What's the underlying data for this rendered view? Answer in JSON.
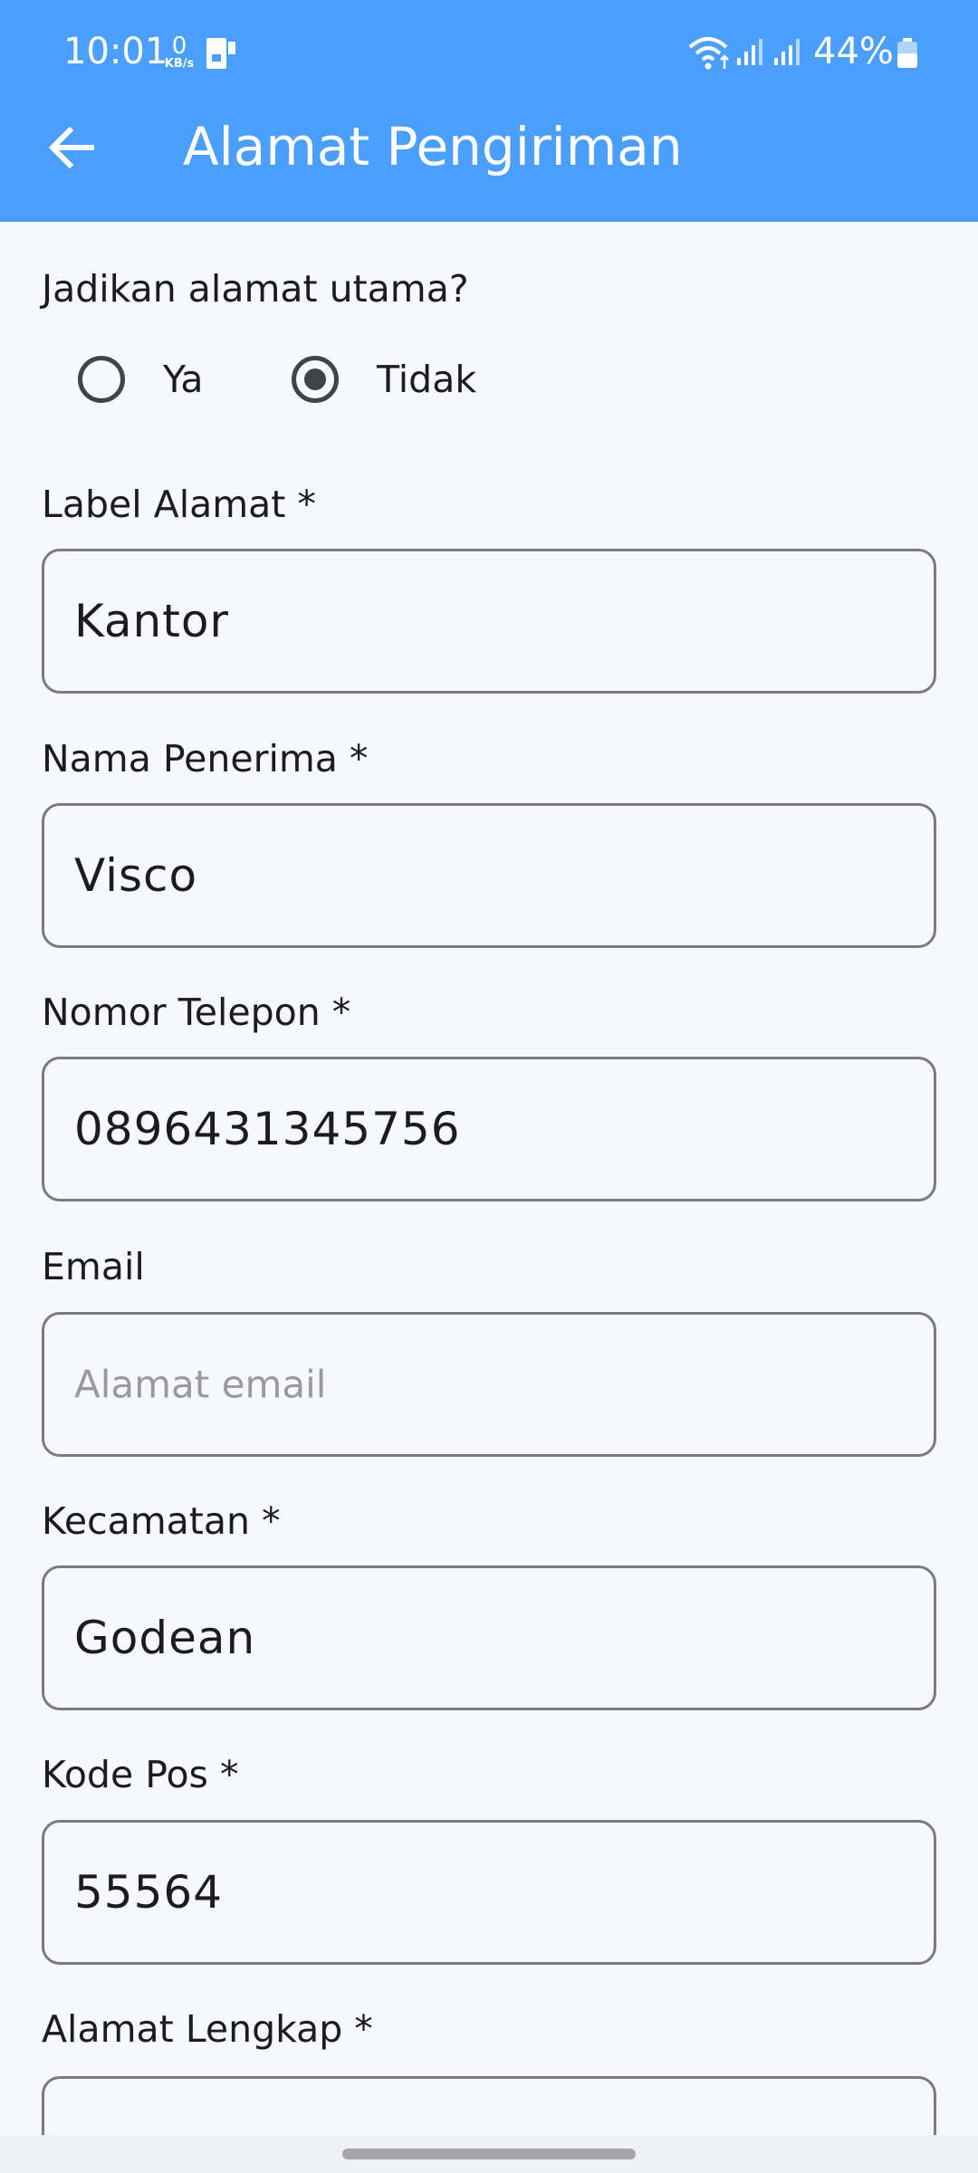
{
  "status_bar": {
    "time": "10:01",
    "net_speed_value": "0",
    "net_speed_unit": "KB/s",
    "battery": "44%"
  },
  "app_bar": {
    "title": "Alamat Pengiriman",
    "back_icon": "arrow-left-icon",
    "color": "#4a9efc"
  },
  "primary_question": {
    "label": "Jadikan alamat utama?",
    "options": [
      {
        "label": "Ya",
        "selected": false
      },
      {
        "label": "Tidak",
        "selected": true
      }
    ]
  },
  "fields": [
    {
      "label": "Label Alamat *",
      "value": "Kantor",
      "placeholder": ""
    },
    {
      "label": "Nama Penerima *",
      "value": "Visco",
      "placeholder": ""
    },
    {
      "label": "Nomor Telepon *",
      "value": "0896431345756",
      "placeholder": ""
    },
    {
      "label": "Email",
      "value": "",
      "placeholder": "Alamat email"
    },
    {
      "label": "Kecamatan *",
      "value": "Godean",
      "placeholder": ""
    },
    {
      "label": "Kode Pos *",
      "value": "55564",
      "placeholder": ""
    },
    {
      "label": "Alamat Lengkap *",
      "value": "",
      "placeholder": ""
    }
  ]
}
